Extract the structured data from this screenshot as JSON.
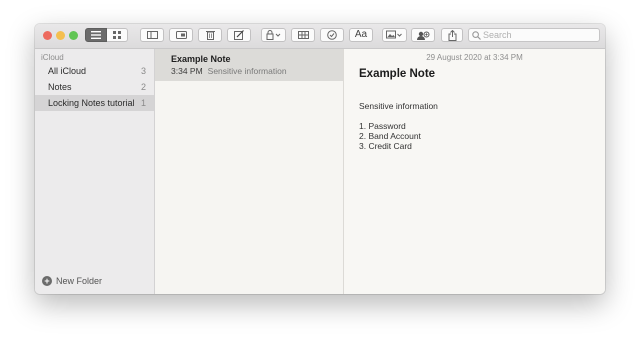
{
  "window": {
    "traffic_lights": [
      "#ed6a5e",
      "#f4bf4f",
      "#61c554"
    ]
  },
  "toolbar": {
    "buttons": [
      {
        "icon": "list-view-icon",
        "active": true
      },
      {
        "icon": "gallery-view-icon",
        "active": false
      },
      {
        "icon": "sidebar-toggle-icon"
      },
      {
        "icon": "attachments-icon"
      },
      {
        "icon": "trash-icon"
      },
      {
        "icon": "compose-icon"
      },
      {
        "icon": "lock-icon"
      },
      {
        "icon": "table-icon"
      },
      {
        "icon": "checklist-icon"
      },
      {
        "icon": "media-icon"
      },
      {
        "icon": "collaborate-icon"
      },
      {
        "icon": "share-icon"
      }
    ],
    "format_label": "Aa",
    "search_placeholder": "Search"
  },
  "sidebar": {
    "section_label": "iCloud",
    "items": [
      {
        "label": "All iCloud",
        "count": "3"
      },
      {
        "label": "Notes",
        "count": "2"
      },
      {
        "label": "Locking Notes tutorial",
        "count": "1"
      }
    ],
    "new_folder_label": "New Folder"
  },
  "note_list": {
    "notes": [
      {
        "title": "Example Note",
        "time": "3:34 PM",
        "preview": "Sensitive information"
      }
    ]
  },
  "editor": {
    "date": "29 August 2020 at 3:34 PM",
    "title": "Example Note",
    "body": "Sensitive information",
    "list": [
      "1. Password",
      "2. Band Account",
      "3. Credit Card"
    ]
  }
}
